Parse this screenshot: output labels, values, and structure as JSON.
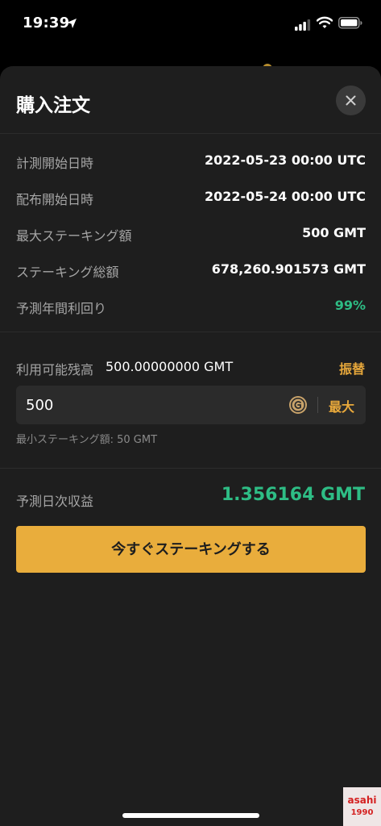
{
  "status_bar": {
    "time": "19:39"
  },
  "sheet": {
    "title": "購入注文",
    "info_rows": [
      {
        "label": "計測開始日時",
        "value": "2022-05-23 00:00 UTC"
      },
      {
        "label": "配布開始日時",
        "value": "2022-05-24 00:00 UTC"
      },
      {
        "label": "最大ステーキング額",
        "value": "500 GMT"
      },
      {
        "label": "ステーキング総額",
        "value": "678,260.901573 GMT"
      },
      {
        "label": "予測年間利回り",
        "value": "99%"
      }
    ],
    "balance": {
      "label": "利用可能残高",
      "value": "500.00000000 GMT",
      "transfer_label": "振替"
    },
    "amount_input": {
      "value": "500",
      "max_label": "最大"
    },
    "min_hint": "最小ステーキング額: 50 GMT",
    "profit": {
      "label": "予測日次収益",
      "value": "1.356164 GMT"
    },
    "stake_button_label": "今すぐステーキングする"
  },
  "watermark": {
    "line1": "asahi",
    "line2": "1990"
  },
  "colors": {
    "accent": "#e9ad3c",
    "positive": "#2ebd85",
    "sheet_bg": "#1e1e1e"
  },
  "icons": {
    "location": "location-arrow-icon",
    "signal": "cellular-signal-icon",
    "wifi": "wifi-icon",
    "battery": "battery-icon",
    "close": "close-icon",
    "coin": "gmt-coin-icon"
  }
}
